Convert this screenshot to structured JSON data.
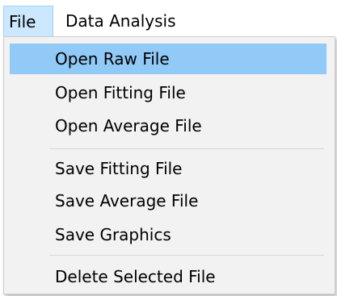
{
  "menubar": {
    "items": [
      {
        "label": "File"
      },
      {
        "label": "Data Analysis"
      }
    ]
  },
  "file_menu": {
    "groups": [
      {
        "items": [
          {
            "label": "Open Raw File",
            "highlighted": true
          },
          {
            "label": "Open Fitting File"
          },
          {
            "label": "Open Average File"
          }
        ]
      },
      {
        "items": [
          {
            "label": "Save Fitting File"
          },
          {
            "label": "Save Average File"
          },
          {
            "label": "Save Graphics"
          }
        ]
      },
      {
        "items": [
          {
            "label": "Delete Selected File"
          }
        ]
      }
    ]
  },
  "colors": {
    "highlight": "#91c9f7",
    "menu_background": "#f2f2f2",
    "active_menubar_item": "#cce8ff"
  }
}
